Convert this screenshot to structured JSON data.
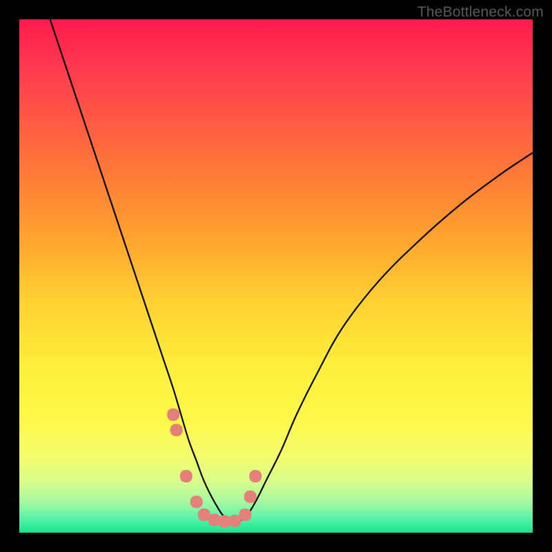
{
  "watermark": "TheBottleneck.com",
  "colors": {
    "frame": "#000000",
    "marker": "#e48079",
    "curve": "#000000",
    "gradient_top": "#ff1a4d",
    "gradient_bottom": "#16e58e"
  },
  "chart_data": {
    "type": "line",
    "title": "",
    "xlabel": "",
    "ylabel": "",
    "xlim": [
      0,
      100
    ],
    "ylim": [
      0,
      100
    ],
    "series": [
      {
        "name": "left-branch",
        "x": [
          6,
          10,
          15,
          20,
          23,
          26,
          28,
          30,
          31.5,
          33,
          34.5,
          36,
          38,
          40,
          42
        ],
        "y": [
          100,
          88,
          73,
          58,
          49,
          40,
          34,
          28,
          23,
          18,
          14,
          10,
          6,
          3,
          2
        ]
      },
      {
        "name": "right-branch",
        "x": [
          42,
          44,
          46,
          48,
          51,
          54,
          58,
          63,
          70,
          78,
          86,
          94,
          100
        ],
        "y": [
          2,
          3,
          6,
          10,
          16,
          23,
          31,
          40,
          49,
          57,
          64,
          70,
          74
        ]
      }
    ],
    "markers": {
      "name": "highlighted-points",
      "x": [
        30,
        30.6,
        32.5,
        34.5,
        36,
        38,
        40,
        42,
        44,
        45,
        46
      ],
      "y": [
        23,
        20,
        11,
        6,
        3.5,
        2.5,
        2.2,
        2.3,
        3.5,
        7,
        11
      ]
    }
  }
}
